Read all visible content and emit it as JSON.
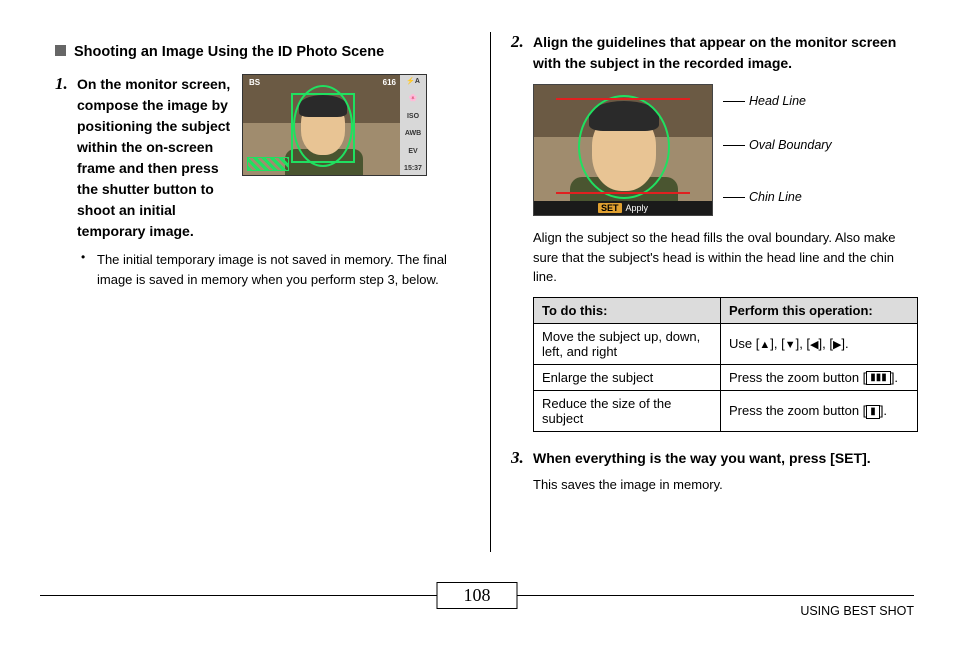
{
  "section_title": "Shooting an Image Using the ID Photo Scene",
  "step1": {
    "text": "On the monitor screen, compose the image by positioning the subject within the on-screen frame and then press the shutter button to shoot an initial temporary image.",
    "bullet": "The initial temporary image is not saved in memory. The final image is saved in memory when you perform step 3, below."
  },
  "cam_overlay": {
    "top_left": "BS",
    "top_right": "616",
    "side": [
      "⚡A",
      "🌸",
      "ISO",
      "AWB",
      "EV",
      "15:37"
    ]
  },
  "step2": {
    "text": "Align the guidelines that appear on the monitor screen with the subject in the recorded image.",
    "callouts": {
      "head": "Head Line",
      "oval": "Oval Boundary",
      "chin": "Chin Line"
    },
    "bottombar": {
      "set": "SET",
      "apply": "Apply"
    },
    "para": "Align the subject so the head fills the oval boundary. Also make sure that the subject's head is within the head line and the chin line."
  },
  "table": {
    "h1": "To do this:",
    "h2": "Perform this operation:",
    "r1c1": "Move the subject up, down, left, and right",
    "r1c2_a": "Use [",
    "r1c2_b": "], [",
    "r1c2_c": "], [",
    "r1c2_d": "], [",
    "r1c2_e": "].",
    "r2c1": "Enlarge the subject",
    "r2c2_a": "Press the zoom button [",
    "r2c2_b": "].",
    "r2_icon": "▮▮▮",
    "r3c1": "Reduce the size of the subject",
    "r3c2_a": "Press the zoom button [",
    "r3c2_b": "].",
    "r3_icon": "▮"
  },
  "step3": {
    "text": "When everything is the way you want, press [SET].",
    "sub": "This saves the image in memory."
  },
  "footer": {
    "page": "108",
    "label": "USING BEST SHOT"
  }
}
